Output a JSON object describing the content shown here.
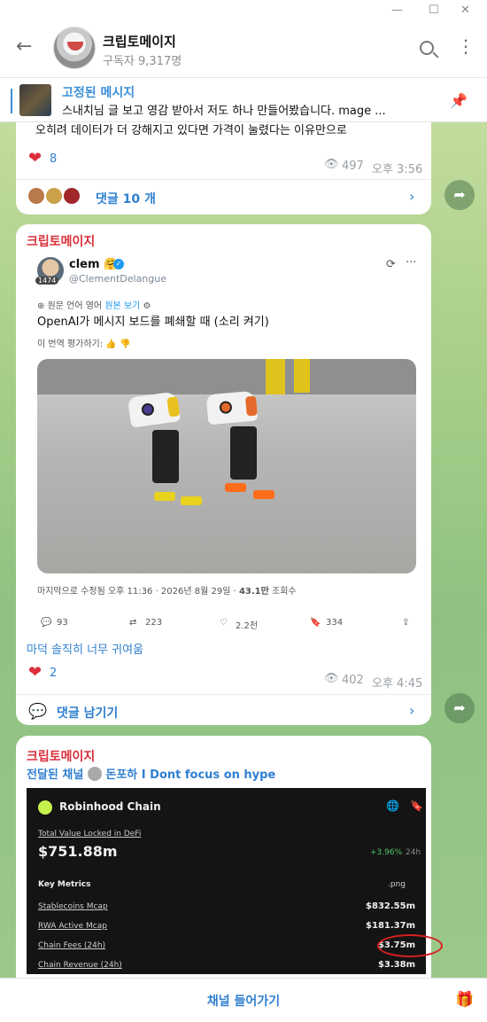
{
  "window": {
    "minimize": "—",
    "maximize": "☐",
    "close": "✕"
  },
  "channel": {
    "title": "크립토메이지",
    "subscribers": "구독자 9,317명"
  },
  "pinned": {
    "title": "고정된 메시지",
    "text": "스내치님 글 보고 영감 받아서 저도 하나 만들어봤습니다. mage ..."
  },
  "post1": {
    "cut_text": "오히려 데이터가 더 강해지고 있다면 가격이 눌렸다는 이유만으로",
    "likes": "8",
    "views": "497",
    "time": "오후 3:56",
    "comments": "댓글 10 개"
  },
  "post2": {
    "sender": "크립토메이지",
    "tweet": {
      "name": "clem 🤗",
      "handle": "@ClementDelangue",
      "badge": "1474",
      "lang_note": "원문 언어 영어",
      "lang_link": "원본 보기",
      "body": "OpenAI가 메시지 보드를 폐쇄할 때 (소리 켜기)",
      "rate": "이 번역 평가하기:",
      "time": "마지막으로 수정됨 오후 11:36 · 2026년 8월 29일 ·",
      "views_count": "43.1만",
      "views_label": "조회수",
      "replies": "93",
      "retweets": "223",
      "likes": "2.2천",
      "bookmarks": "334"
    },
    "caption": "마덕 솔직히 너무 귀여움",
    "likes": "2",
    "views": "402",
    "time": "오후 4:45",
    "comment_prompt": "댓글 남기기"
  },
  "post3": {
    "sender": "크립토메이지",
    "forward_prefix": "전달된 채널",
    "forward_name": "돈포하 I Dont focus on hype",
    "robinhood": {
      "title": "Robinhood Chain",
      "tvl_label": "Total Value Locked in DeFi",
      "tvl": "$751.88m",
      "change": "+3.96%",
      "change_period": "24h",
      "key_metrics": "Key Metrics",
      "png": ".png",
      "rows": [
        {
          "label": "Stablecoins Mcap",
          "value": "$832.55m"
        },
        {
          "label": "RWA Active Mcap",
          "value": "$181.37m"
        },
        {
          "label": "Chain Fees (24h)",
          "value": "$3.75m"
        },
        {
          "label": "Chain Revenue (24h)",
          "value": "$3.38m"
        }
      ]
    }
  },
  "bottom": {
    "join": "채널 들어가기"
  },
  "colors": {
    "accent": "#2f7fd0",
    "sender": "#d9303a",
    "heart": "#d9303a"
  }
}
